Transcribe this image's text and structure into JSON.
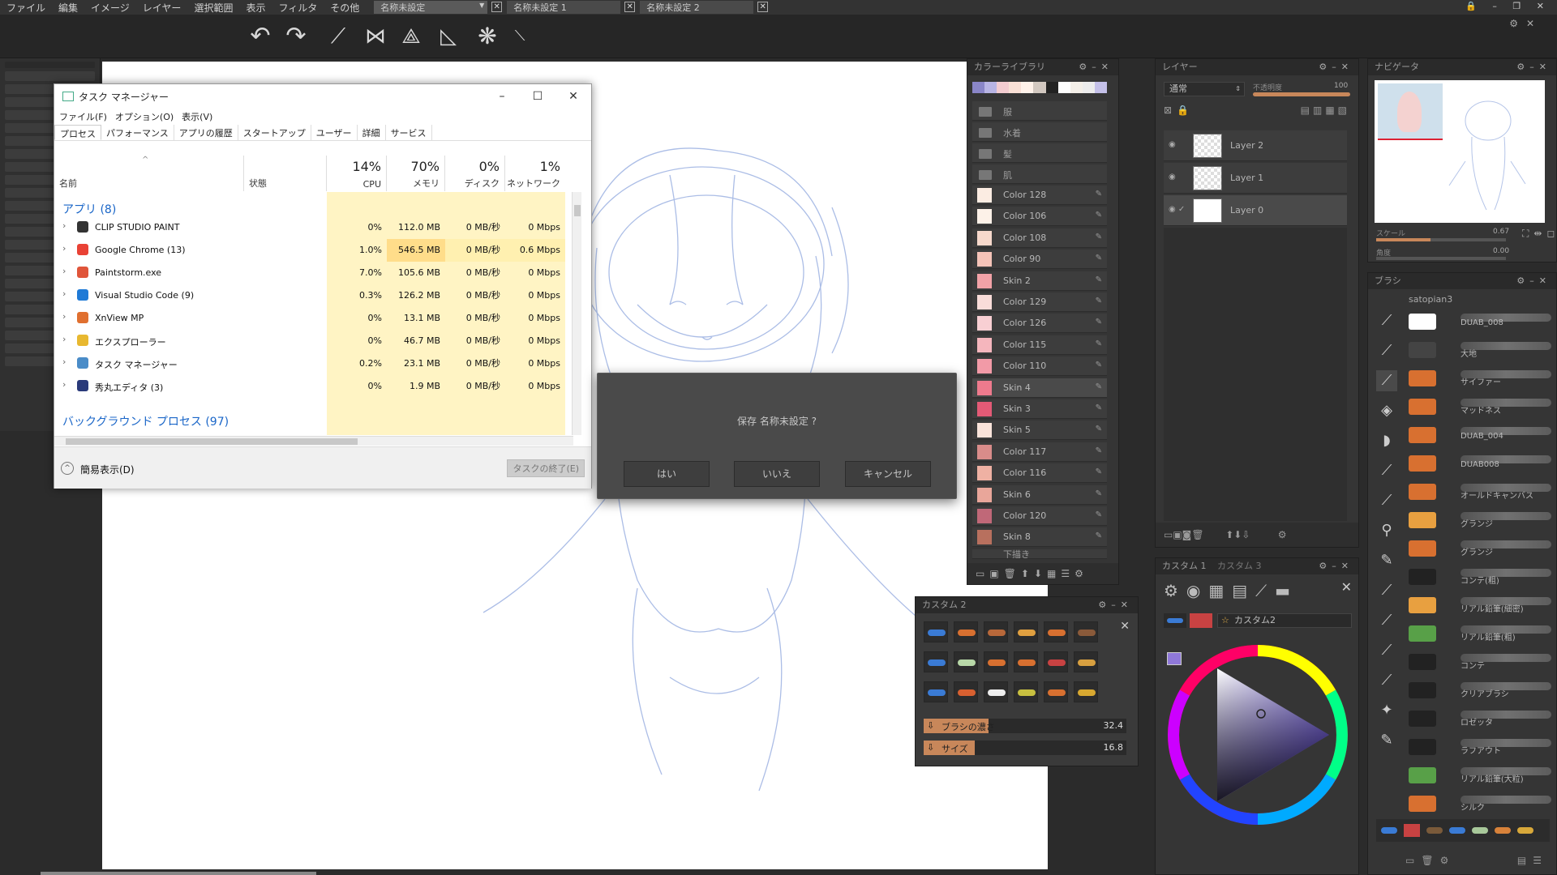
{
  "menubar": {
    "items": [
      "ファイル",
      "編集",
      "イメージ",
      "レイヤー",
      "選択範囲",
      "表示",
      "フィルタ",
      "その他"
    ],
    "doc_tabs": [
      "名称未設定",
      "名称未設定 1",
      "名称未設定 2"
    ]
  },
  "task_manager": {
    "title": "タスク マネージャー",
    "menus": [
      "ファイル(F)",
      "オプション(O)",
      "表示(V)"
    ],
    "tabs": [
      "プロセス",
      "パフォーマンス",
      "アプリの履歴",
      "スタートアップ",
      "ユーザー",
      "詳細",
      "サービス"
    ],
    "columns": {
      "name": "名前",
      "status": "状態",
      "cpu_pct": "14%",
      "cpu": "CPU",
      "mem_pct": "70%",
      "mem": "メモリ",
      "disk_pct": "0%",
      "disk": "ディスク",
      "net_pct": "1%",
      "net": "ネットワーク"
    },
    "group_apps": "アプリ (8)",
    "group_bg": "バックグラウンド プロセス (97)",
    "processes": [
      {
        "name": "CLIP STUDIO PAINT",
        "cpu": "0%",
        "mem": "112.0 MB",
        "disk": "0 MB/秒",
        "net": "0 Mbps"
      },
      {
        "name": "Google Chrome (13)",
        "cpu": "1.0%",
        "mem": "546.5 MB",
        "disk": "0 MB/秒",
        "net": "0.6 Mbps"
      },
      {
        "name": "Paintstorm.exe",
        "cpu": "7.0%",
        "mem": "105.6 MB",
        "disk": "0 MB/秒",
        "net": "0 Mbps"
      },
      {
        "name": "Visual Studio Code (9)",
        "cpu": "0.3%",
        "mem": "126.2 MB",
        "disk": "0 MB/秒",
        "net": "0 Mbps"
      },
      {
        "name": "XnView MP",
        "cpu": "0%",
        "mem": "13.1 MB",
        "disk": "0 MB/秒",
        "net": "0 Mbps"
      },
      {
        "name": "エクスプローラー",
        "cpu": "0%",
        "mem": "46.7 MB",
        "disk": "0 MB/秒",
        "net": "0 Mbps"
      },
      {
        "name": "タスク マネージャー",
        "cpu": "0.2%",
        "mem": "23.1 MB",
        "disk": "0 MB/秒",
        "net": "0 Mbps"
      },
      {
        "name": "秀丸エディタ (3)",
        "cpu": "0%",
        "mem": "1.9 MB",
        "disk": "0 MB/秒",
        "net": "0 Mbps"
      }
    ],
    "fewer_details": "簡易表示(D)",
    "end_task": "タスクの終了(E)"
  },
  "save_dialog": {
    "message": "保存 名称未設定 ?",
    "yes": "はい",
    "no": "いいえ",
    "cancel": "キャンセル"
  },
  "color_library": {
    "title": "カラーライブラリ",
    "folders": [
      "服",
      "水着",
      "髪",
      "肌"
    ],
    "colors": [
      {
        "name": "Color 128",
        "hex": "#fbece2"
      },
      {
        "name": "Color 106",
        "hex": "#fdf1e8"
      },
      {
        "name": "Color 108",
        "hex": "#f7d9cc"
      },
      {
        "name": "Color 90",
        "hex": "#f5c3b8"
      },
      {
        "name": "Skin 2",
        "hex": "#f2a2a7"
      },
      {
        "name": "Color 129",
        "hex": "#f9dcd9"
      },
      {
        "name": "Color 126",
        "hex": "#f8cfd3"
      },
      {
        "name": "Color 115",
        "hex": "#f5b6bd"
      },
      {
        "name": "Color 110",
        "hex": "#f29aa7"
      },
      {
        "name": "Skin 4",
        "hex": "#ee7a8d"
      },
      {
        "name": "Skin 3",
        "hex": "#e35a76"
      },
      {
        "name": "Skin 5",
        "hex": "#f9e3da"
      },
      {
        "name": "Color 117",
        "hex": "#d98c8a"
      },
      {
        "name": "Color 116",
        "hex": "#efb1a3"
      },
      {
        "name": "Skin 6",
        "hex": "#e9a69a"
      },
      {
        "name": "Color 120",
        "hex": "#c06878"
      },
      {
        "name": "Skin 8",
        "hex": "#b8705e"
      }
    ],
    "last_folder": "下描き"
  },
  "layers": {
    "title": "レイヤー",
    "blend_mode": "通常",
    "opacity_label": "不透明度",
    "opacity_value": "100",
    "items": [
      "Layer 2",
      "Layer 1",
      "Layer 0"
    ]
  },
  "navigator": {
    "title": "ナビゲータ",
    "scale_label": "スケール",
    "scale_value": "0.67",
    "angle_label": "角度",
    "angle_value": "0.00"
  },
  "brush_panel": {
    "title": "ブラシ",
    "set_name": "satopian3",
    "brushes": [
      "DUAB_008",
      "大地",
      "サイファー",
      "マッドネス",
      "DUAB_004",
      "DUAB008",
      "オールドキャンバス",
      "グランジ",
      "グランジ",
      "コンテ(粗)",
      "リアル鉛筆(細密)",
      "リアル鉛筆(粗)",
      "コンテ",
      "クリアブラシ",
      "ロゼッタ",
      "ラフアウト",
      "リアル鉛筆(大粒)",
      "シルク"
    ]
  },
  "custom_tabs": {
    "tab1": "カスタム 1",
    "tab3": "カスタム 3",
    "preset_name": "カスタム2"
  },
  "custom2_panel": {
    "title": "カスタム 2",
    "density_label": "ブラシの濃さ",
    "density_value": "32.4",
    "density_level": 0.32,
    "size_label": "サイズ",
    "size_value": "16.8",
    "size_level": 0.25
  },
  "colors": {
    "accent": "#3a7bd5",
    "process_highlight": "#fff4c4",
    "mem_highlight": "#ffdd8a",
    "selected_color": "#8f78d8"
  }
}
